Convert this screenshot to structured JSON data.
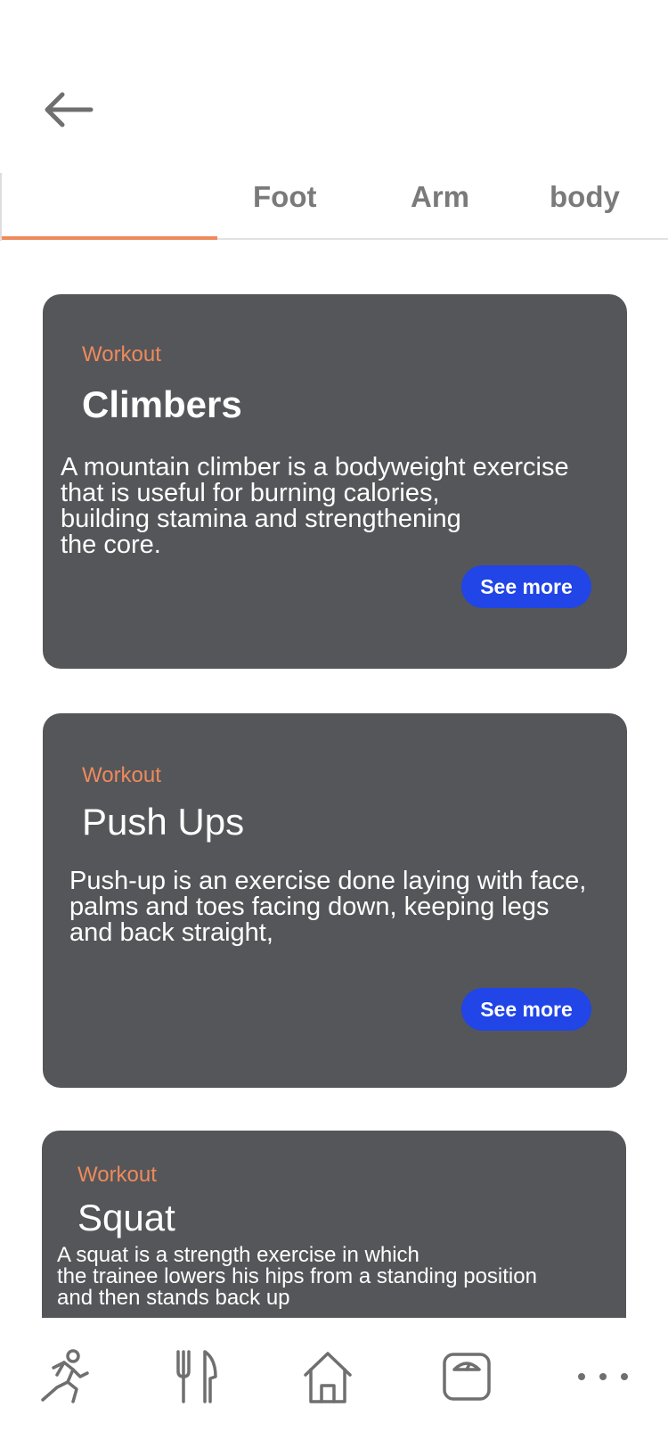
{
  "header": {
    "back_icon": "arrow-left-icon"
  },
  "tabs": [
    {
      "label": "",
      "active": true
    },
    {
      "label": "Foot",
      "active": false
    },
    {
      "label": "Arm",
      "active": false
    },
    {
      "label": "body",
      "active": false
    }
  ],
  "colors": {
    "accent": "#ee8a5c",
    "card_bg": "#555659",
    "button": "#2145e6",
    "icon": "#6f6f6f"
  },
  "cards": [
    {
      "tag": "Workout",
      "title": "Climbers",
      "description": "A mountain climber is a bodyweight exercise\nthat is useful for burning calories,\nbuilding stamina and strengthening\nthe core.",
      "button": "See more"
    },
    {
      "tag": "Workout",
      "title": "Push Ups",
      "description": "Push-up is an exercise done laying with face,\npalms and toes facing down, keeping legs\nand back straight,",
      "button": "See more"
    },
    {
      "tag": "Workout",
      "title": "Squat",
      "description": "A squat is a strength exercise in which\nthe trainee lowers his hips from a standing position\nand then stands back up"
    }
  ],
  "bottom_nav": [
    {
      "icon": "running-icon"
    },
    {
      "icon": "fork-knife-icon"
    },
    {
      "icon": "home-icon"
    },
    {
      "icon": "scale-icon"
    },
    {
      "icon": "more-icon"
    }
  ]
}
